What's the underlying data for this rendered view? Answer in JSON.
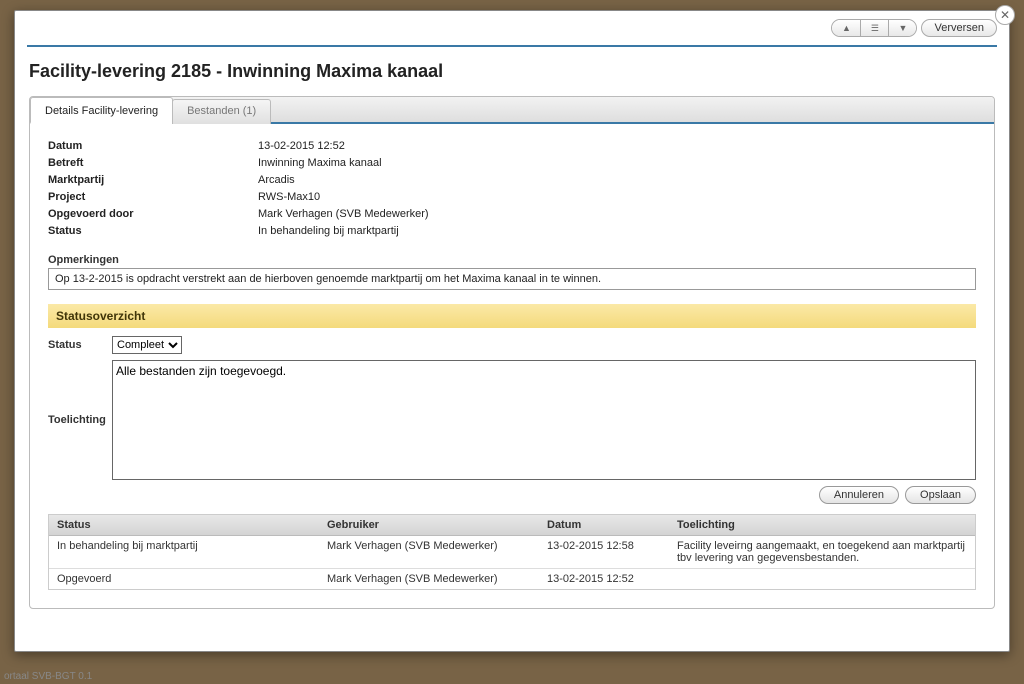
{
  "bg_footer": "ortaal SVB-BGT 0.1",
  "toolbar": {
    "refresh": "Verversen"
  },
  "page_title": "Facility-levering 2185 - Inwinning Maxima kanaal",
  "tabs": [
    {
      "label": "Details Facility-levering"
    },
    {
      "label": "Bestanden (1)"
    }
  ],
  "details": {
    "datum_label": "Datum",
    "datum_value": "13-02-2015 12:52",
    "betreft_label": "Betreft",
    "betreft_value": "Inwinning Maxima kanaal",
    "marktpartij_label": "Marktpartij",
    "marktpartij_value": "Arcadis",
    "project_label": "Project",
    "project_value": "RWS-Max10",
    "opgevoerd_label": "Opgevoerd door",
    "opgevoerd_value": "Mark Verhagen (SVB Medewerker)",
    "status_label": "Status",
    "status_value": "In behandeling bij marktpartij"
  },
  "opmerkingen": {
    "label": "Opmerkingen",
    "value": "Op 13-2-2015 is opdracht verstrekt aan de hierboven genoemde marktpartij om het Maxima kanaal in te winnen."
  },
  "statusoverzicht": {
    "heading": "Statusoverzicht",
    "status_label": "Status",
    "status_selected": "Compleet",
    "toelichting_label": "Toelichting",
    "toelichting_value": "Alle bestanden zijn toegevoegd.",
    "cancel": "Annuleren",
    "save": "Opslaan"
  },
  "history": {
    "headers": {
      "status": "Status",
      "gebruiker": "Gebruiker",
      "datum": "Datum",
      "toelichting": "Toelichting"
    },
    "rows": [
      {
        "status": "In behandeling bij marktpartij",
        "gebruiker": "Mark Verhagen (SVB Medewerker)",
        "datum": "13-02-2015 12:58",
        "toelichting": "Facility leveirng aangemaakt, en toegekend aan marktpartij tbv levering van gegevensbestanden."
      },
      {
        "status": "Opgevoerd",
        "gebruiker": "Mark Verhagen (SVB Medewerker)",
        "datum": "13-02-2015 12:52",
        "toelichting": ""
      }
    ]
  }
}
